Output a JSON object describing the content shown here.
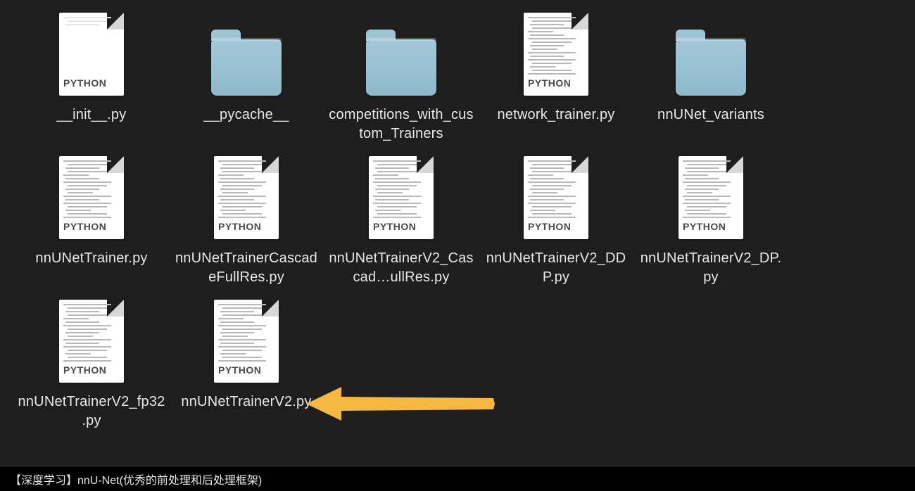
{
  "python_band_label": "PYTHON",
  "items": [
    {
      "name": "__init__.py",
      "type": "pyfile",
      "variant": "blank"
    },
    {
      "name": "__pycache__",
      "type": "folder"
    },
    {
      "name": "competitions_with_custom_Trainers",
      "type": "folder"
    },
    {
      "name": "network_trainer.py",
      "type": "pyfile",
      "variant": "text"
    },
    {
      "name": "nnUNet_variants",
      "type": "folder"
    },
    {
      "name": "nnUNetTrainer.py",
      "type": "pyfile",
      "variant": "text"
    },
    {
      "name": "nnUNetTrainerCascadeFullRes.py",
      "type": "pyfile",
      "variant": "text"
    },
    {
      "name": "nnUNetTrainerV2_Cascad…ullRes.py",
      "type": "pyfile",
      "variant": "text"
    },
    {
      "name": "nnUNetTrainerV2_DDP.py",
      "type": "pyfile",
      "variant": "text"
    },
    {
      "name": "nnUNetTrainerV2_DP.py",
      "type": "pyfile",
      "variant": "text"
    },
    {
      "name": "nnUNetTrainerV2_fp32.py",
      "type": "pyfile",
      "variant": "text"
    },
    {
      "name": "nnUNetTrainerV2.py",
      "type": "pyfile",
      "variant": "text"
    }
  ],
  "arrow": {
    "color": "#f5b942"
  },
  "footer_text": "【深度学习】nnU-Net(优秀的前处理和后处理框架)"
}
